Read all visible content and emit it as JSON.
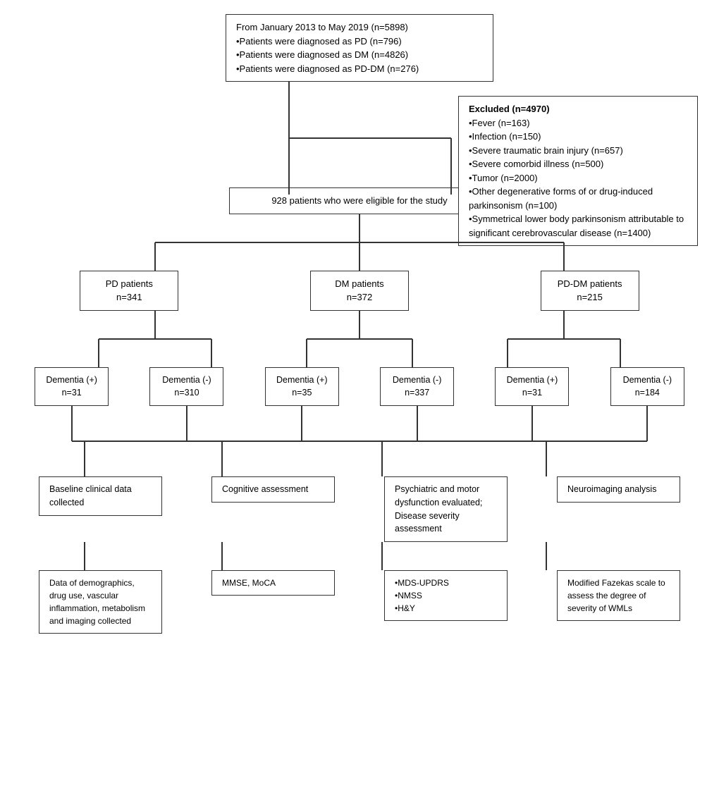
{
  "top_box": {
    "line1": "From January 2013 to May 2019 (n=5898)",
    "line2": "•Patients were diagnosed as PD (n=796)",
    "line3": "•Patients were diagnosed as DM (n=4826)",
    "line4": "•Patients were diagnosed as PD-DM (n=276)"
  },
  "excluded_box": {
    "title": "Excluded (n=4970)",
    "items": [
      "•Fever (n=163)",
      "•Infection (n=150)",
      "•Severe traumatic brain injury (n=657)",
      "•Severe comorbid illness (n=500)",
      "•Tumor (n=2000)",
      "•Other degenerative forms of or drug-induced parkinsonism (n=100)",
      "•Symmetrical lower body parkinsonism attributable to significant cerebrovascular disease (n=1400)"
    ]
  },
  "eligible_box": {
    "text": "928 patients who were eligible for the study"
  },
  "groups": [
    {
      "label": "PD patients",
      "n": "n=341"
    },
    {
      "label": "DM patients",
      "n": "n=372"
    },
    {
      "label": "PD-DM patients",
      "n": "n=215"
    }
  ],
  "dementia_groups": [
    {
      "sign": "Dementia (+)",
      "n": "n=31",
      "parent": "PD"
    },
    {
      "sign": "Dementia (-)",
      "n": "n=310",
      "parent": "PD"
    },
    {
      "sign": "Dementia (+)",
      "n": "n=35",
      "parent": "DM"
    },
    {
      "sign": "Dementia (-)",
      "n": "n=337",
      "parent": "DM"
    },
    {
      "sign": "Dementia (+)",
      "n": "n=31",
      "parent": "PD-DM"
    },
    {
      "sign": "Dementia (-)",
      "n": "n=184",
      "parent": "PD-DM"
    }
  ],
  "assessment_boxes": [
    {
      "title": "Baseline clinical data collected",
      "detail": "Data of demographics, drug use, vascular inflammation, metabolism and imaging collected"
    },
    {
      "title": "Cognitive assessment",
      "detail": "MMSE, MoCA"
    },
    {
      "title": "Psychiatric and motor dysfunction evaluated; Disease severity assessment",
      "detail": "•MDS-UPDRS\n•NMSS\n•H&Y"
    },
    {
      "title": "Neuroimaging analysis",
      "detail": "Modified Fazekas scale to assess the degree of severity of WMLs"
    }
  ]
}
